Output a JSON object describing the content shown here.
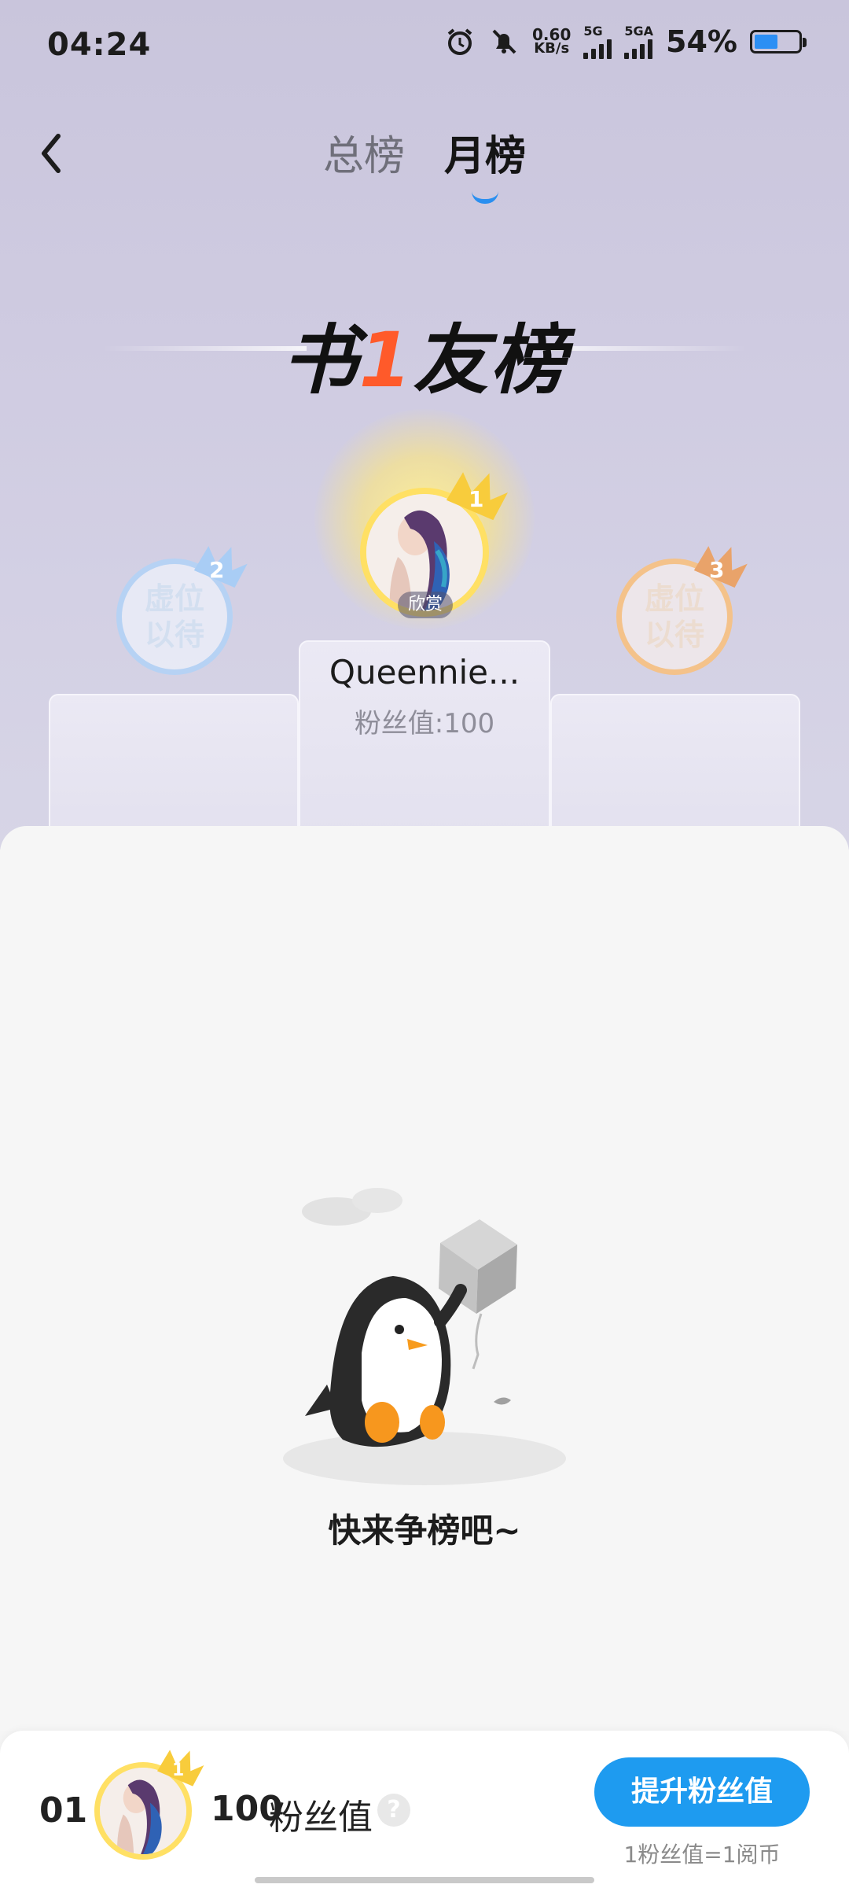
{
  "status_bar": {
    "time": "04:24",
    "net_speed_value": "0.60",
    "net_speed_unit": "KB/s",
    "sim1_label": "5G",
    "sim2_label": "5GA",
    "battery_percent": "54%",
    "battery_level": 0.54,
    "icons": [
      "alarm-icon",
      "mute-bell-icon",
      "signal-icon",
      "battery-icon"
    ]
  },
  "nav": {
    "tabs": [
      {
        "label": "总榜",
        "active": false
      },
      {
        "label": "月榜",
        "active": true
      }
    ]
  },
  "logo": {
    "part1": "书",
    "accent": "1",
    "part2": "友榜"
  },
  "podium": {
    "first": {
      "rank": "1",
      "name": "Queennie...",
      "score": "粉丝值:100",
      "tag": "欣赏"
    },
    "second": {
      "rank": "2",
      "placeholder_line1": "虚位",
      "placeholder_line2": "以待"
    },
    "third": {
      "rank": "3",
      "placeholder_line1": "虚位",
      "placeholder_line2": "以待"
    }
  },
  "empty_state": {
    "message": "快来争榜吧~"
  },
  "my_status": {
    "rank": "01",
    "crown_rank": "1",
    "score": "100",
    "score_label": "粉丝值",
    "help": "?",
    "boost_button": "提升粉丝值",
    "note": "1粉丝值=1阅币"
  },
  "colors": {
    "accent_blue": "#1e9bf0",
    "gold": "#ffe064",
    "silver": "#b6d2f4",
    "bronze": "#f4c28a",
    "logo_accent": "#ff5a2a"
  }
}
